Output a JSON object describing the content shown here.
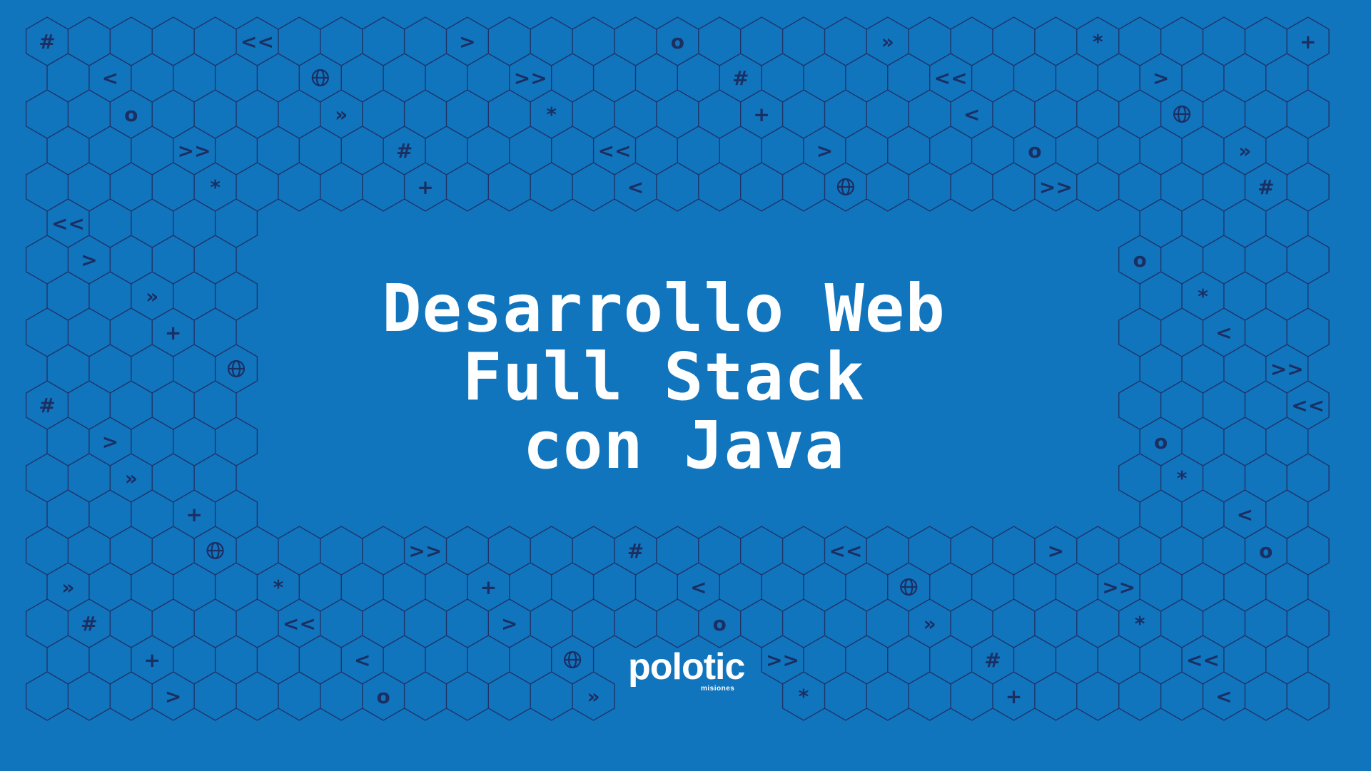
{
  "title": {
    "line1": "Desarrollo Web",
    "line2": "Full Stack",
    "line3": " con Java"
  },
  "logo": {
    "brand": "polotic",
    "subtitle": "misiones"
  },
  "colors": {
    "background": "#1175be",
    "pattern_line": "#1f3468",
    "pattern_glyph": "#1b2f63",
    "text": "#ffffff"
  },
  "pattern_symbols": [
    "#",
    "<<",
    ">",
    "o",
    "»",
    "*",
    "+",
    "<",
    "globe",
    ">>"
  ]
}
